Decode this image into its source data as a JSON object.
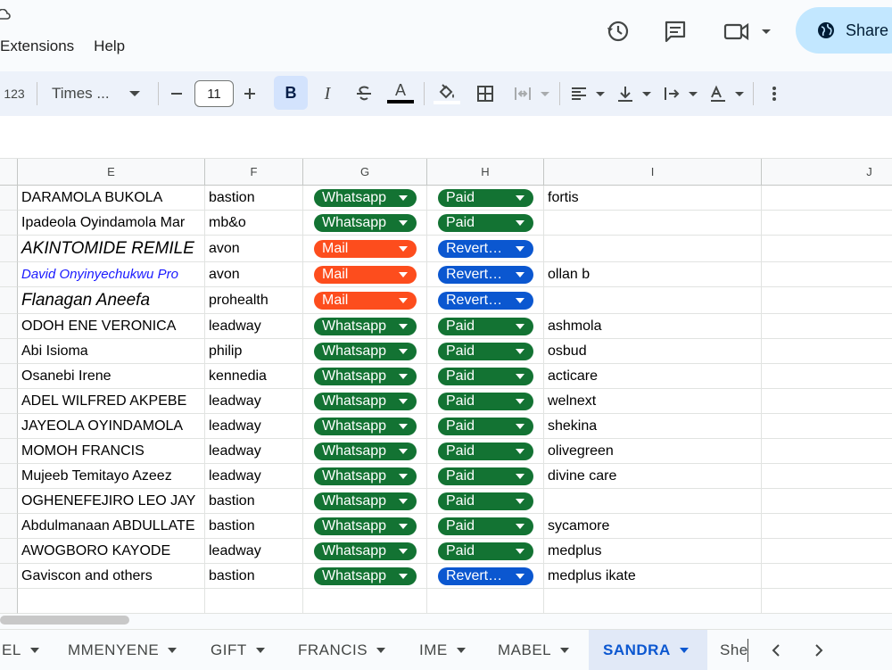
{
  "menu": [
    "Extensions",
    "Help"
  ],
  "share_label": "Share",
  "toolbar": {
    "number_format": "123",
    "font": "Times ...",
    "font_size": "11",
    "bold": "B",
    "italic": "I",
    "text_color_glyph": "A"
  },
  "columns": [
    "E",
    "F",
    "G",
    "H",
    "I",
    "J"
  ],
  "colors": {
    "whatsapp": "#137333",
    "mail": "#fd4d1d",
    "paid": "#137333",
    "revert": "#0b57d0",
    "active_tab": "#0b57d0"
  },
  "rows": [
    {
      "name": "DARAMOLA  BUKOLA",
      "provider": "bastion",
      "channel": "Whatsapp",
      "status": "Paid",
      "note": "fortis",
      "style": "normal"
    },
    {
      "name": " Ipadeola Oyindamola  Mar",
      "provider": "mb&o",
      "channel": "Whatsapp",
      "status": "Paid",
      "note": "",
      "style": "normal"
    },
    {
      "name": "AKINTOMIDE REMILE",
      "provider": "avon",
      "channel": "Mail",
      "status": "Revert…",
      "note": "",
      "style": "italic-large"
    },
    {
      "name": " David Onyinyechukwu Pro",
      "provider": "avon",
      "channel": "Mail",
      "status": "Revert…",
      "note": "ollan b",
      "style": "italic-blue"
    },
    {
      "name": "Flanagan Aneefa",
      "provider": "prohealth",
      "channel": "Mail",
      "status": "Revert…",
      "note": "",
      "style": "italic-large"
    },
    {
      "name": "ODOH ENE VERONICA",
      "provider": "leadway",
      "channel": "Whatsapp",
      "status": "Paid",
      "note": "ashmola",
      "style": "normal"
    },
    {
      "name": " Abi  Isioma",
      "provider": "philip",
      "channel": "Whatsapp",
      "status": "Paid",
      "note": "osbud",
      "style": "normal"
    },
    {
      "name": "Osanebi Irene",
      "provider": "kennedia",
      "channel": "Whatsapp",
      "status": "Paid",
      "note": "acticare",
      "style": "normal"
    },
    {
      "name": "ADEL WILFRED   AKPEBE",
      "provider": "leadway",
      "channel": "Whatsapp",
      "status": "Paid",
      "note": "welnext",
      "style": "normal"
    },
    {
      "name": "JAYEOLA    OYINDAMOLA",
      "provider": "leadway",
      "channel": "Whatsapp",
      "status": "Paid",
      "note": "shekina",
      "style": "normal"
    },
    {
      "name": "MOMOH  FRANCIS",
      "provider": "leadway",
      "channel": "Whatsapp",
      "status": "Paid",
      "note": "olivegreen",
      "style": "normal"
    },
    {
      "name": "Mujeeb Temitayo Azeez",
      "provider": "leadway",
      "channel": "Whatsapp",
      "status": "Paid",
      "note": "divine care",
      "style": "normal"
    },
    {
      "name": "OGHENEFEJIRO LEO JAY",
      "provider": "bastion",
      "channel": "Whatsapp",
      "status": "Paid",
      "note": "",
      "style": "normal"
    },
    {
      "name": "Abdulmanaan ABDULLATE",
      "provider": "bastion",
      "channel": "Whatsapp",
      "status": "Paid",
      "note": "sycamore",
      "style": "normal"
    },
    {
      "name": "AWOGBORO  KAYODE",
      "provider": "leadway",
      "channel": "Whatsapp",
      "status": "Paid",
      "note": "medplus",
      "style": "normal"
    },
    {
      "name": "Gaviscon and others",
      "provider": "bastion",
      "channel": "Whatsapp",
      "status": "Revert…",
      "note": "medplus ikate",
      "style": "normal"
    }
  ],
  "tabs": [
    "EL",
    "MMENYENE",
    "GIFT",
    "FRANCIS",
    "IME",
    "MABEL",
    "SANDRA",
    "She"
  ],
  "active_tab": "SANDRA"
}
